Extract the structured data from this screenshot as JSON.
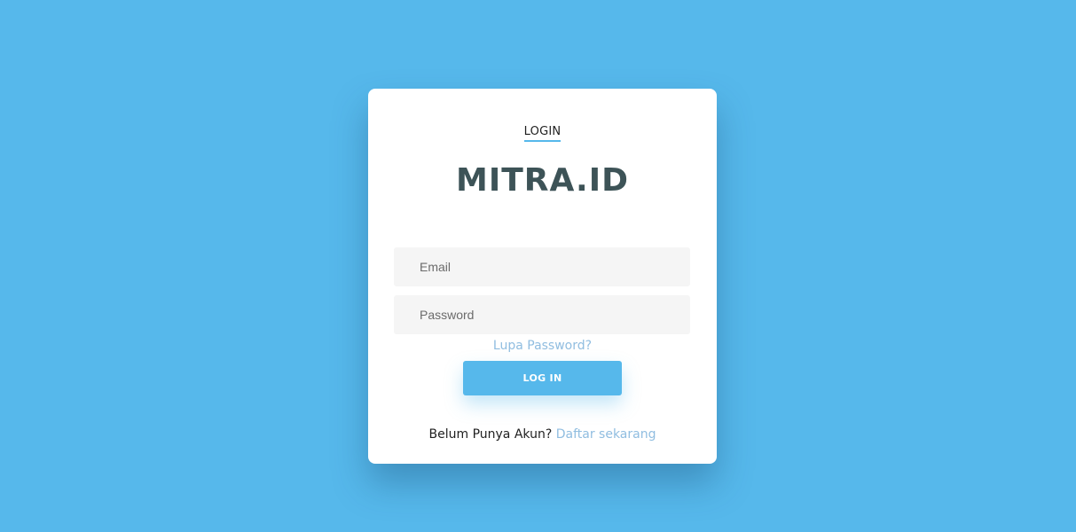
{
  "login_card": {
    "tab_label": "LOGIN",
    "brand": "MITRA.ID",
    "email": {
      "placeholder": "Email",
      "value": ""
    },
    "password": {
      "placeholder": "Password",
      "value": ""
    },
    "forgot_link": "Lupa Password?",
    "login_button": "LOG IN",
    "register_prompt": "Belum Punya Akun?",
    "register_link": "Daftar sekarang"
  },
  "colors": {
    "background": "#56b8eb",
    "accent": "#56b8eb",
    "link": "#90bde0",
    "brand_text": "#3d5357",
    "card": "#ffffff"
  }
}
